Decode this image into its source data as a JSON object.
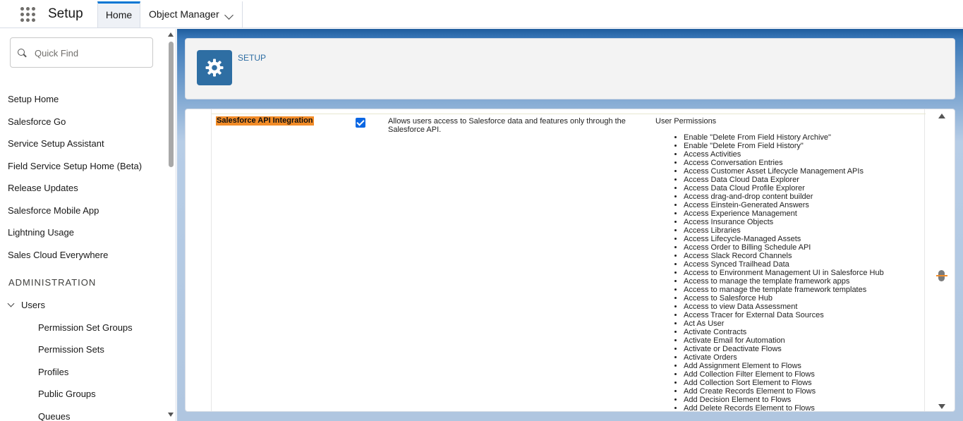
{
  "header": {
    "app_name": "Setup",
    "tabs": [
      {
        "label": "Home",
        "active": true
      },
      {
        "label": "Object Manager"
      }
    ]
  },
  "sidebar": {
    "quick_find_placeholder": "Quick Find",
    "items": [
      "Setup Home",
      "Salesforce Go",
      "Service Setup Assistant",
      "Field Service Setup Home (Beta)",
      "Release Updates",
      "Salesforce Mobile App",
      "Lightning Usage",
      "Sales Cloud Everywhere"
    ],
    "section_heading": "ADMINISTRATION",
    "users_label": "Users",
    "users_children": [
      "Permission Set Groups",
      "Permission Sets",
      "Profiles",
      "Public Groups",
      "Queues"
    ]
  },
  "page_header": {
    "label": "SETUP",
    "icon": "gear-icon"
  },
  "permission_row": {
    "name": "Salesforce API Integration",
    "checked": true,
    "description": "Allows users access to Salesforce data and features only through the Salesforce API.",
    "column_heading": "User Permissions",
    "permissions": [
      "Enable \"Delete From Field History Archive\"",
      "Enable \"Delete From Field History\"",
      "Access Activities",
      "Access Conversation Entries",
      "Access Customer Asset Lifecycle Management APIs",
      "Access Data Cloud Data Explorer",
      "Access Data Cloud Profile Explorer",
      "Access drag-and-drop content builder",
      "Access Einstein-Generated Answers",
      "Access Experience Management",
      "Access Insurance Objects",
      "Access Libraries",
      "Access Lifecycle-Managed Assets",
      "Access Order to Billing Schedule API",
      "Access Slack Record Channels",
      "Access Synced Trailhead Data",
      "Access to Environment Management UI in Salesforce Hub",
      "Access to manage the template framework apps",
      "Access to manage the template framework templates",
      "Access to Salesforce Hub",
      "Access to view Data Assessment",
      "Access Tracer for External Data Sources",
      "Act As User",
      "Activate Contracts",
      "Activate Email for Automation",
      "Activate or Deactivate Flows",
      "Activate Orders",
      "Add Assignment Element to Flows",
      "Add Collection Filter Element to Flows",
      "Add Collection Sort Element to Flows",
      "Add Create Records Element to Flows",
      "Add Decision Element to Flows",
      "Add Delete Records Element to Flows"
    ]
  },
  "colors": {
    "highlight": "#f28c28",
    "brand_blue": "#2e6ea3",
    "checkbox": "#0b67e3"
  }
}
